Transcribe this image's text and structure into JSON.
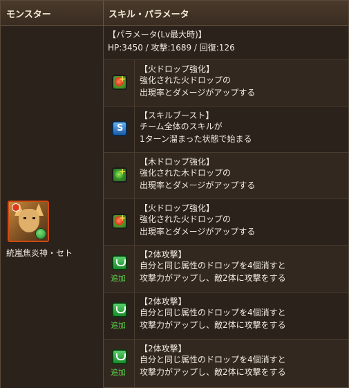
{
  "header": {
    "monster_label": "モンスター",
    "skill_label": "スキル・パラメータ"
  },
  "monster": {
    "name": "統嵐焦炎神・セト",
    "icon": "seto-portrait-icon",
    "attribute_icon": "wood-attribute-icon"
  },
  "params": {
    "title": "【パラメータ(Lv最大時)】",
    "stats": "HP:3450 / 攻撃:1689 / 回復:126"
  },
  "skills": [
    {
      "icon": "fire-drop-enhance-icon",
      "title": "【火ドロップ強化】",
      "line1": "強化された火ドロップの",
      "line2": "出現率とダメージがアップする",
      "extra": ""
    },
    {
      "icon": "skill-boost-icon",
      "title": "【スキルブースト】",
      "line1": "チーム全体のスキルが",
      "line2": "1ターン溜まった状態で始まる",
      "extra": ""
    },
    {
      "icon": "wood-drop-enhance-icon",
      "title": "【木ドロップ強化】",
      "line1": "強化された木ドロップの",
      "line2": "出現率とダメージがアップする",
      "extra": ""
    },
    {
      "icon": "fire-drop-enhance-icon",
      "title": "【火ドロップ強化】",
      "line1": "強化された火ドロップの",
      "line2": "出現率とダメージがアップする",
      "extra": ""
    },
    {
      "icon": "two-target-attack-icon",
      "title": "【2体攻撃】",
      "line1": "自分と同じ属性のドロップを4個消すと",
      "line2": "攻撃力がアップし、敵2体に攻撃をする",
      "extra": "追加"
    },
    {
      "icon": "two-target-attack-icon",
      "title": "【2体攻撃】",
      "line1": "自分と同じ属性のドロップを4個消すと",
      "line2": "攻撃力がアップし、敵2体に攻撃をする",
      "extra": "追加"
    },
    {
      "icon": "two-target-attack-icon",
      "title": "【2体攻撃】",
      "line1": "自分と同じ属性のドロップを4個消すと",
      "line2": "攻撃力がアップし、敵2体に攻撃をする",
      "extra": "追加"
    }
  ]
}
